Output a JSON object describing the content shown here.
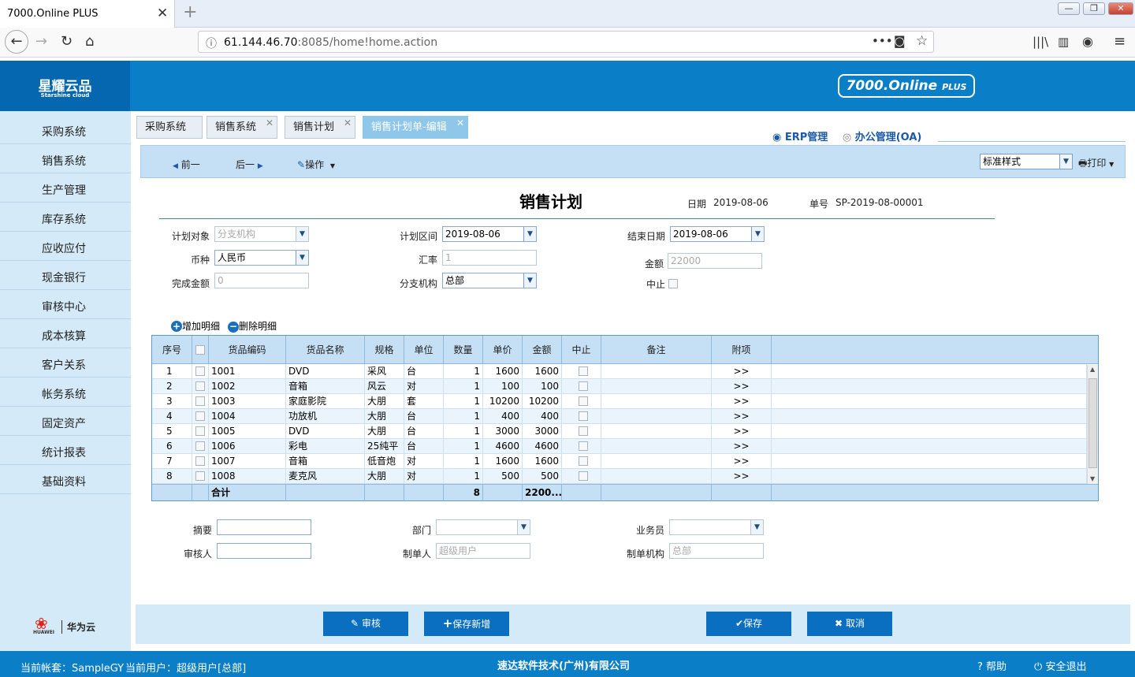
{
  "browser": {
    "tab_title": "7000.Online PLUS",
    "url_host": "61.144.46.70",
    "url_path": ":8085/home!home.action",
    "win_min": "—",
    "win_max": "❐",
    "win_close": "✕"
  },
  "app": {
    "logo_cn": "星耀云品",
    "logo_en": "Starshine cloud",
    "brand": "7000.Online",
    "brand_plus": "PLUS",
    "huawei": "华为云",
    "huawei_small": "HUAWEI"
  },
  "sidebar": {
    "items": [
      "采购系统",
      "销售系统",
      "生产管理",
      "库存系统",
      "应收应付",
      "现金银行",
      "审核中心",
      "成本核算",
      "客户关系",
      "帐务系统",
      "固定资产",
      "统计报表",
      "基础资料"
    ]
  },
  "tabs": [
    {
      "label": "采购系统"
    },
    {
      "label": "销售系统"
    },
    {
      "label": "销售计划"
    },
    {
      "label": "销售计划单-编辑"
    }
  ],
  "mode": {
    "erp": "ERP管理",
    "oa": "办公管理(OA)"
  },
  "toolbar": {
    "prev": "前一",
    "next": "后一",
    "ops": "操作",
    "style": "标准样式",
    "print": "打印"
  },
  "form": {
    "title": "销售计划",
    "date_label": "日期",
    "date": "2019-08-06",
    "no_label": "单号",
    "no": "SP-2019-08-00001",
    "target_label": "计划对象",
    "target_placeholder": "分支机构",
    "period_label": "计划区间",
    "period_start": "2019-08-06",
    "end_label": "结束日期",
    "end_date": "2019-08-06",
    "currency_label": "币种",
    "currency": "人民币",
    "rate_label": "汇率",
    "rate": "1",
    "amount_label": "金额",
    "amount": "22000",
    "done_label": "完成金额",
    "done": "0",
    "branch_label": "分支机构",
    "branch": "总部",
    "stop_label": "中止"
  },
  "detail": {
    "add": "增加明细",
    "del": "删除明细"
  },
  "grid": {
    "headers": [
      "序号",
      "",
      "货品编码",
      "货品名称",
      "规格",
      "单位",
      "数量",
      "单价",
      "金额",
      "中止",
      "备注",
      "附项"
    ],
    "rows": [
      [
        "1",
        "1001",
        "DVD",
        "采风",
        "台",
        "1",
        "1600",
        "1600",
        ">>"
      ],
      [
        "2",
        "1002",
        "音箱",
        "风云",
        "对",
        "1",
        "100",
        "100",
        ">>"
      ],
      [
        "3",
        "1003",
        "家庭影院",
        "大朋",
        "套",
        "1",
        "10200",
        "10200",
        ">>"
      ],
      [
        "4",
        "1004",
        "功放机",
        "大朋",
        "台",
        "1",
        "400",
        "400",
        ">>"
      ],
      [
        "5",
        "1005",
        "DVD",
        "大朋",
        "台",
        "1",
        "3000",
        "3000",
        ">>"
      ],
      [
        "6",
        "1006",
        "彩电",
        "25纯平",
        "台",
        "1",
        "4600",
        "4600",
        ">>"
      ],
      [
        "7",
        "1007",
        "音箱",
        "低音炮",
        "对",
        "1",
        "1600",
        "1600",
        ">>"
      ],
      [
        "8",
        "1008",
        "麦克风",
        "大朋",
        "对",
        "1",
        "500",
        "500",
        ">>"
      ]
    ],
    "total_label": "合计",
    "total_qty": "8",
    "total_amount": "2200..."
  },
  "bottom": {
    "summary_label": "摘要",
    "dept_label": "部门",
    "sales_label": "业务员",
    "auditor_label": "审核人",
    "maker_label": "制单人",
    "maker": "超级用户",
    "maker_org_label": "制单机构",
    "maker_org": "总部"
  },
  "buttons": {
    "audit": "审核",
    "save_new": "保存新增",
    "save": "保存",
    "cancel": "取消"
  },
  "footer": {
    "account": "当前帐套：SampleGY",
    "user": "当前用户：超级用户[总部]",
    "company": "速达软件技术(广州)有限公司",
    "help": "帮助",
    "logout": "安全退出"
  }
}
